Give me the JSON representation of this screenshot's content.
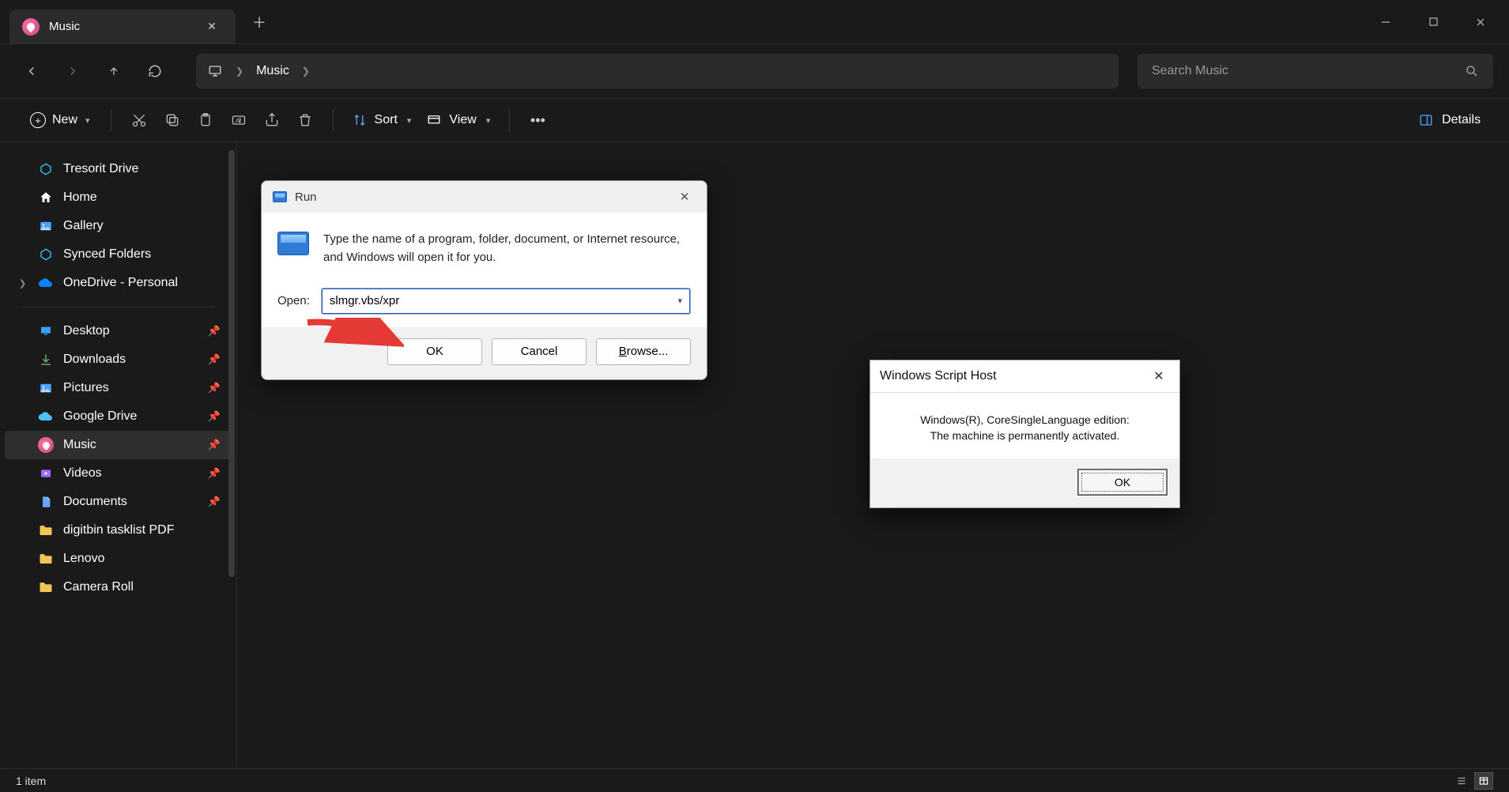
{
  "tab": {
    "title": "Music"
  },
  "breadcrumb": {
    "item": "Music"
  },
  "search": {
    "placeholder": "Search Music"
  },
  "toolbar": {
    "new_label": "New",
    "sort_label": "Sort",
    "view_label": "View",
    "details_label": "Details"
  },
  "sidebar": {
    "items_top": [
      {
        "label": "Tresorit Drive",
        "icon": "tresorit"
      },
      {
        "label": "Home",
        "icon": "home"
      },
      {
        "label": "Gallery",
        "icon": "gallery"
      },
      {
        "label": "Synced Folders",
        "icon": "synced"
      },
      {
        "label": "OneDrive - Personal",
        "icon": "onedrive",
        "expandable": true
      }
    ],
    "items_pinned": [
      {
        "label": "Desktop",
        "icon": "desktop",
        "pinned": true
      },
      {
        "label": "Downloads",
        "icon": "downloads",
        "pinned": true
      },
      {
        "label": "Pictures",
        "icon": "pictures",
        "pinned": true
      },
      {
        "label": "Google Drive",
        "icon": "gdrive",
        "pinned": true
      },
      {
        "label": "Music",
        "icon": "music",
        "pinned": true,
        "selected": true
      },
      {
        "label": "Videos",
        "icon": "videos",
        "pinned": true
      },
      {
        "label": "Documents",
        "icon": "documents",
        "pinned": true
      },
      {
        "label": "digitbin tasklist PDF",
        "icon": "folder"
      },
      {
        "label": "Lenovo",
        "icon": "folder"
      },
      {
        "label": "Camera Roll",
        "icon": "folder"
      }
    ]
  },
  "statusbar": {
    "text": "1 item"
  },
  "run_dialog": {
    "title": "Run",
    "description": "Type the name of a program, folder, document, or Internet resource, and Windows will open it for you.",
    "open_label": "Open:",
    "value": "slmgr.vbs/xpr",
    "ok": "OK",
    "cancel": "Cancel",
    "browse": "Browse..."
  },
  "wsh_dialog": {
    "title": "Windows Script Host",
    "line1": "Windows(R), CoreSingleLanguage edition:",
    "line2": "The machine is permanently activated.",
    "ok": "OK"
  }
}
